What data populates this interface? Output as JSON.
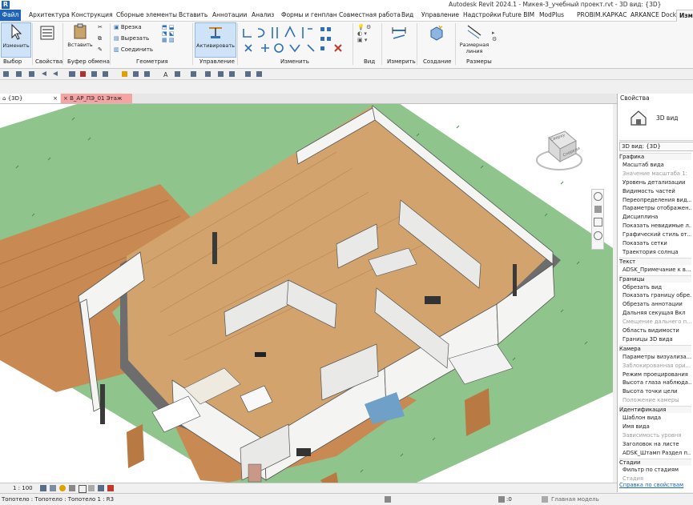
{
  "app": {
    "logo": "R",
    "title": "Autodesk Revit 2024.1 - Микея-3_учебный проект.rvt - 3D вид: {3D}"
  },
  "menu": {
    "items": [
      "Файл",
      "Архитектура",
      "Конструкция",
      "Сборные элементы",
      "Вставить",
      "Аннотации",
      "Анализ",
      "Формы и генплан",
      "Совместная работа",
      "Вид",
      "Управление",
      "Надстройки",
      "Future BIM",
      "ModPlus",
      "PROBIM.КАРКАС",
      "ARKANCE Dock",
      "Изме"
    ]
  },
  "ribbon": {
    "modify_label": "Изменить",
    "insert_label": "Вставить",
    "activate_label": "Активировать",
    "small_buttons": [
      "Врезка",
      "Вырезать",
      "Соединить"
    ],
    "create_label": "Создание",
    "measure_label": "Измерить",
    "dimension_label": "Размерная линия",
    "groups": [
      "Выбор",
      "Свойства",
      "Буфер обмена",
      "Геометрия",
      "Управление",
      "Изменить",
      "Вид",
      "Измерить",
      "Создание",
      "Размеры"
    ]
  },
  "view_tabs": [
    {
      "label": "{3D}",
      "close": "×"
    },
    {
      "label": "В_АР_ПЭ_01 Этаж",
      "close": "×"
    }
  ],
  "view_status": {
    "scale": "1 : 100",
    "icons": [
      "detail-level-icon",
      "visual-style-icon",
      "sun-path-icon",
      "shadows-icon",
      "crop-icon",
      "unlock-icon",
      "temporary-hide-icon",
      "reveal-hidden-icon"
    ]
  },
  "status_bar": {
    "text": "Топотело : Топотело : Топотело 1 : R3",
    "selection_count": ":0",
    "model": "Главная модель"
  },
  "viewcube": {
    "top": "Сверху",
    "front": "Спереди"
  },
  "properties": {
    "header": "Свойства",
    "type_name": "3D вид",
    "instance_label": "3D вид: {3D}",
    "rows": [
      {
        "text": "Графика",
        "group": true
      },
      {
        "text": "Масштаб вида",
        "group": false
      },
      {
        "text": "Значение масштаба    1:",
        "dim": true
      },
      {
        "text": "Уровень детализации",
        "group": false
      },
      {
        "text": "Видимость частей",
        "group": false
      },
      {
        "text": "Переопределения вид...",
        "group": false
      },
      {
        "text": "Параметры отображен...",
        "group": false
      },
      {
        "text": "Дисциплина",
        "group": false
      },
      {
        "text": "Показать невидимые л...",
        "group": false
      },
      {
        "text": "Графический стиль от...",
        "group": false
      },
      {
        "text": "Показать сетки",
        "group": false
      },
      {
        "text": "Траектория солнца",
        "group": false
      },
      {
        "text": "Текст",
        "group": true
      },
      {
        "text": "ADSK_Примечание к в...",
        "group": false
      },
      {
        "text": "Границы",
        "group": true
      },
      {
        "text": "Обрезать вид",
        "group": false
      },
      {
        "text": "Показать границу обре...",
        "group": false
      },
      {
        "text": "Обрезать аннотации",
        "group": false
      },
      {
        "text": "Дальняя секущая Вкл",
        "group": false
      },
      {
        "text": "Смещение дальнего п...",
        "dim": true
      },
      {
        "text": "Область видимости",
        "group": false
      },
      {
        "text": "Границы 3D вида",
        "group": false
      },
      {
        "text": "Камера",
        "group": true
      },
      {
        "text": "Параметры визуализа...",
        "group": false
      },
      {
        "text": "Заблокированная ори...",
        "dim": true
      },
      {
        "text": "Режим проецирования",
        "group": false
      },
      {
        "text": "Высота глаза наблюда...",
        "group": false
      },
      {
        "text": "Высота точки цели",
        "group": false
      },
      {
        "text": "Положение камеры",
        "dim": true
      },
      {
        "text": "Идентификация",
        "group": true
      },
      {
        "text": "Шаблон вида",
        "group": false
      },
      {
        "text": "Имя вида",
        "group": false
      },
      {
        "text": "Зависимость уровня",
        "dim": true
      },
      {
        "text": "Заголовок на листе",
        "group": false
      },
      {
        "text": "ADSK_Штамп Раздел п...",
        "group": false
      },
      {
        "text": "Стадии",
        "group": true
      },
      {
        "text": "Фильтр по стадиям",
        "group": false
      },
      {
        "text": "Стадия",
        "dim": true
      }
    ],
    "help_link": "Справка по свойствам"
  },
  "colors": {
    "accent": "#1f63b5",
    "grass": "#8fc48c",
    "deck": "#c88a52",
    "wall": "#f4f4f2",
    "floor": "#d2a36c",
    "active_tab_red": "#f5a4a4"
  }
}
